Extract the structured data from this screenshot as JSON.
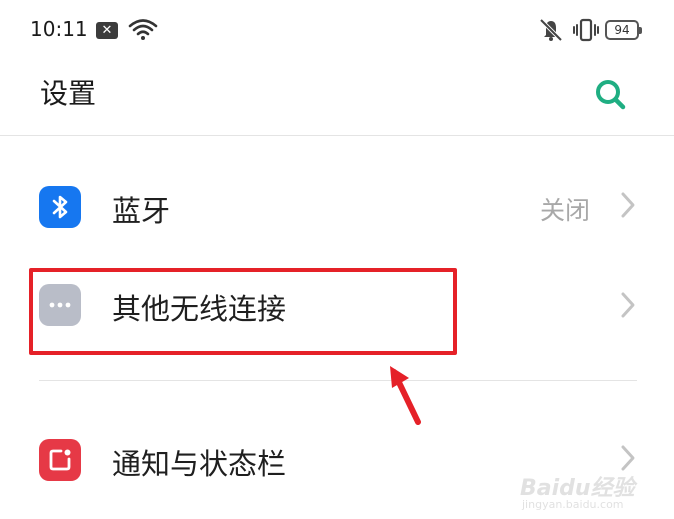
{
  "status_bar": {
    "time": "10:11",
    "battery": "94"
  },
  "header": {
    "title": "设置"
  },
  "settings": [
    {
      "label": "蓝牙",
      "value": "关闭"
    },
    {
      "label": "其他无线连接",
      "value": ""
    },
    {
      "label": "通知与状态栏",
      "value": ""
    }
  ],
  "watermark": {
    "brand": "Baidu经验",
    "url": "jingyan.baidu.com"
  },
  "colors": {
    "accent": "#1fae82",
    "bluetooth": "#1677f0",
    "other_wireless": "#b9bdc8",
    "notification": "#e63946",
    "highlight": "#e52128"
  },
  "icons": [
    "notification-x-icon",
    "wifi-icon",
    "mute-icon",
    "vibrate-icon",
    "battery-icon",
    "search-icon",
    "bluetooth-icon",
    "more-dots-icon",
    "notification-icon",
    "chevron-right-icon",
    "arrow-icon"
  ]
}
